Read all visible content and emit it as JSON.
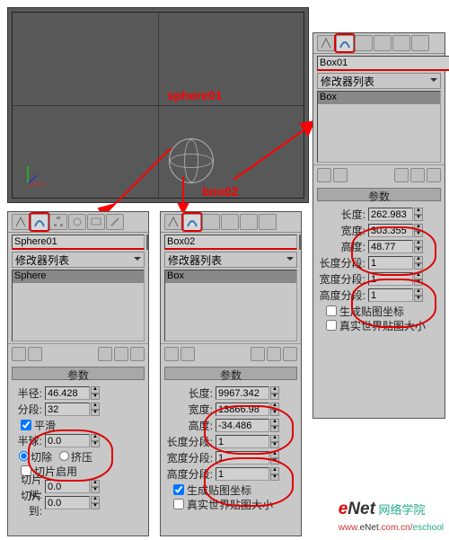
{
  "labels": {
    "sphere": "sphere01",
    "box": "box02"
  },
  "sphere_panel": {
    "name": "Sphere01",
    "droplabel": "修改器列表",
    "listitem": "Sphere",
    "section": "参数",
    "radius_label": "半径:",
    "radius": "46.428",
    "seg_label": "分段:",
    "seg": "32",
    "smooth": "平滑",
    "hemi_label": "半球:",
    "hemi": "0.0",
    "r1": "切除",
    "r2": "挤压",
    "slice_on": "切片启用",
    "slice_from": "切片从:",
    "slice_from_v": "0.0",
    "slice_to": "切片到:",
    "slice_to_v": "0.0"
  },
  "box02_panel": {
    "name": "Box02",
    "droplabel": "修改器列表",
    "listitem": "Box",
    "section": "参数",
    "len_label": "长度:",
    "len": "9967.342",
    "wid_label": "宽度:",
    "wid": "13866.98",
    "hgt_label": "高度:",
    "hgt": "-34.486",
    "lseg_label": "长度分段:",
    "lseg": "1",
    "wseg_label": "宽度分段:",
    "wseg": "1",
    "hseg_label": "高度分段:",
    "hseg": "1",
    "gen_map": "生成贴图坐标",
    "real_world": "真实世界贴图大小"
  },
  "box01_panel": {
    "name": "Box01",
    "droplabel": "修改器列表",
    "listitem": "Box",
    "section": "参数",
    "len_label": "长度:",
    "len": "262.983",
    "wid_label": "宽度:",
    "wid": "303.355",
    "hgt_label": "高度:",
    "hgt": "48.77",
    "lseg_label": "长度分段:",
    "lseg": "1",
    "wseg_label": "宽度分段:",
    "wseg": "1",
    "hseg_label": "高度分段:",
    "hseg": "1",
    "gen_map": "生成贴图坐标",
    "real_world": "真实世界贴图大小"
  },
  "watermark": {
    "txt1": "网络学院",
    "txt2": "www.eNet.com.cn/eschool"
  }
}
